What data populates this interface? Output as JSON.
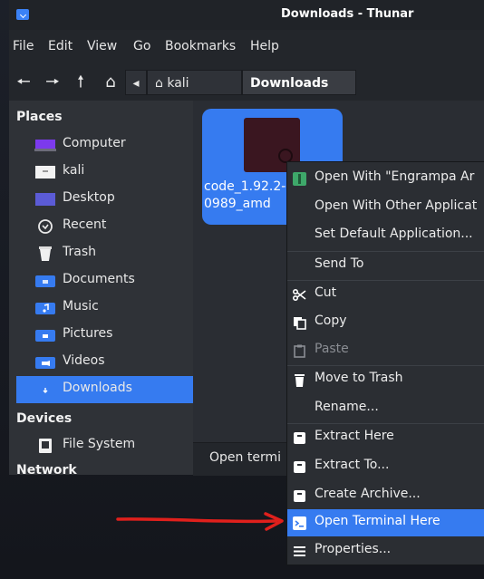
{
  "window": {
    "title": "Downloads - Thunar"
  },
  "menubar": {
    "items": [
      "File",
      "Edit",
      "View",
      "Go",
      "Bookmarks",
      "Help"
    ]
  },
  "toolbar": {
    "path": [
      "kali",
      "Downloads"
    ]
  },
  "sidebar": {
    "places_label": "Places",
    "places": [
      "Computer",
      "kali",
      "Desktop",
      "Recent",
      "Trash",
      "Documents",
      "Music",
      "Pictures",
      "Videos",
      "Downloads"
    ],
    "devices_label": "Devices",
    "devices": [
      "File System"
    ],
    "network_label": "Network"
  },
  "file": {
    "name_line1": "code_1.92.2-",
    "name_line2": "0989_amd"
  },
  "statusbar": {
    "text": "Open termi"
  },
  "context_menu": {
    "items": [
      "Open With \"Engrampa Ar",
      "Open With Other Applicat",
      "Set Default Application...",
      "Send To",
      "Cut",
      "Copy",
      "Paste",
      "Move to Trash",
      "Rename...",
      "Extract Here",
      "Extract To...",
      "Create Archive...",
      "Open Terminal Here",
      "Properties..."
    ]
  },
  "colors": {
    "accent": "#367bf0",
    "annotation": "#e0201c"
  }
}
